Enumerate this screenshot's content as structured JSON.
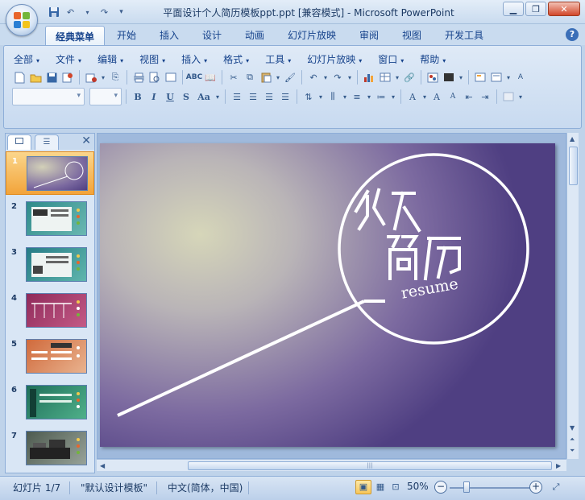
{
  "window": {
    "title": "平面设计个人简历模板ppt.ppt [兼容模式] - Microsoft PowerPoint",
    "minimize_icon": "minimize-icon",
    "maximize_icon": "restore-icon",
    "close_icon": "close-icon"
  },
  "qat": [
    "save-icon",
    "undo-icon",
    "redo-icon",
    "customize-icon"
  ],
  "tabs": [
    {
      "label": "经典菜单",
      "active": true
    },
    {
      "label": "开始"
    },
    {
      "label": "插入"
    },
    {
      "label": "设计"
    },
    {
      "label": "动画"
    },
    {
      "label": "幻灯片放映"
    },
    {
      "label": "审阅"
    },
    {
      "label": "视图"
    },
    {
      "label": "开发工具"
    }
  ],
  "help_label": "?",
  "menus": [
    "全部",
    "文件",
    "编辑",
    "视图",
    "插入",
    "格式",
    "工具",
    "幻灯片放映",
    "窗口",
    "帮助"
  ],
  "format_buttons": {
    "bold": "B",
    "italic": "I",
    "underline": "U",
    "shadow": "S",
    "case": "Aa"
  },
  "pane": {
    "tab_slides_icon": "slides-tab-icon",
    "tab_outline_icon": "outline-tab-icon",
    "close_label": "✕"
  },
  "slides": [
    {
      "num": "1",
      "selected": true
    },
    {
      "num": "2"
    },
    {
      "num": "3"
    },
    {
      "num": "4"
    },
    {
      "num": "5"
    },
    {
      "num": "6"
    },
    {
      "num": "7"
    }
  ],
  "slide": {
    "resume_text": "resume"
  },
  "status": {
    "slide_info": "幻灯片 1/7",
    "theme": "\"默认设计模板\"",
    "language": "中文(简体，中国)",
    "zoom": "50%",
    "zoom_minus": "−",
    "zoom_plus": "+"
  },
  "colors": {
    "accent": "#15428b",
    "ribbon": "#dfeaf7",
    "selected_slide": "#f2a43a",
    "slide_purple": "#4f3f82"
  }
}
